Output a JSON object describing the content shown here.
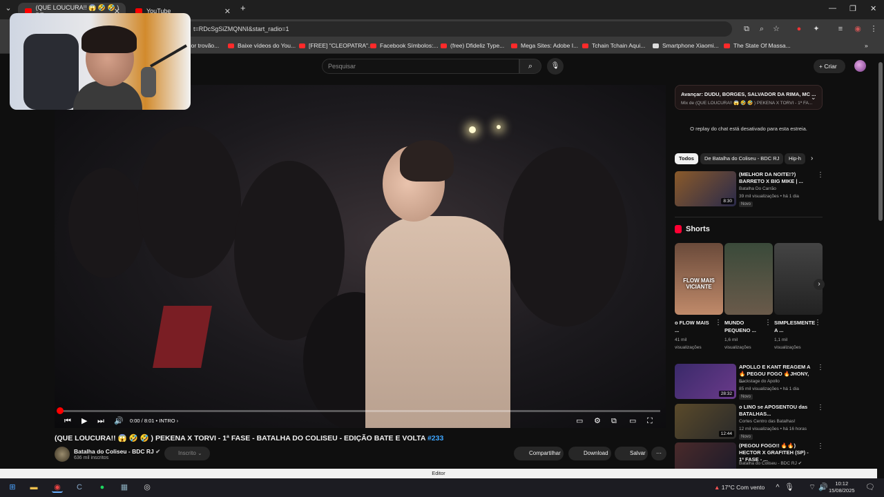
{
  "browser": {
    "tabs": [
      {
        "label": "(QUE LOUCURA!! 😱 🤣 🤣 ) PE"
      },
      {
        "label": "YouTube"
      }
    ],
    "url": "t=RDcSgSiZMQNNI&start_radio=1",
    "bookmarks": [
      "aior trovão...",
      "Baixe vídeos do You...",
      "[FREE] \"CLEOPATRA\"...",
      "Facebook Símbolos:...",
      "(free) Dfideliz Type...",
      "Mega Sites: Adobe I...",
      "Tchain Tchain Aqui...",
      "Smartphone Xiaomi...",
      "The State Of Massa..."
    ]
  },
  "youtube": {
    "search_placeholder": "Pesquisar",
    "create_label": "Criar"
  },
  "player": {
    "time": "0:00 / 8:01",
    "chapter": "INTRO",
    "progress_fraction": 0.0
  },
  "video": {
    "title": "(QUE LOUCURA!! 😱 🤣 🤣 ) PEKENA X TORVI - 1ª FASE - BATALHA DO COLISEU - EDIÇÃO BATE E VOLTA",
    "tag": "#233",
    "channel": "Batalha do Coliseu - BDC RJ",
    "subscribers": "636 mil inscritos",
    "subscribed_label": "Inscrito",
    "share_label": "Compartilhar",
    "download_label": "Download",
    "save_label": "Salvar"
  },
  "sidebar": {
    "mix_title": "Avançar: DUDU, BORGES, SALVADOR DA RIMA, MC ...",
    "mix_subtitle": "Mix de (QUE LOUCURA!! 😱 🤣 🤣 ) PEKENA X TORVI - 1ª FA...",
    "chat_off": "O replay do chat está desativado para esta estreia.",
    "chips": [
      "Todos",
      "De Batalha do Coliseu - BDC RJ",
      "Hip-h"
    ],
    "shorts_label": "Shorts",
    "recs": [
      {
        "title": "(MELHOR DA NOITE!?) BARRETO X BIG MIKE | ...",
        "channel": "Batalha Do Carrão",
        "meta": "39 mil visualizações • há 1 dia",
        "badge": "Novo",
        "duration": "8:30"
      },
      {
        "title": "APOLLO E KANT REAGEM A 🔥 PEGOU FOGO 🔥JHONY, ...",
        "channel": "Backstage do Apollo",
        "meta": "85 mil visualizações • há 1 dia",
        "badge": "Novo",
        "duration": "28:32"
      },
      {
        "title": "o LINO se APOSENTOU das BATALHAS...",
        "channel": "Cortes Centro das Batalhas!",
        "meta": "12 mil visualizações • há 16 horas",
        "badge": "Novo",
        "duration": "12:44"
      },
      {
        "title": "(PEGOU FOGO!! 🔥🔥) HECTOR X GRAFITEH (SP) - 1ª FASE - ...",
        "channel": "Batalha do Coliseu - BDC RJ ✔",
        "meta": "",
        "badge": "",
        "duration": ""
      }
    ],
    "shorts": [
      {
        "title": "o FLOW MAIS ...",
        "views": "41 mil visualizações",
        "overlay": "FLOW MAIS VICIANTE"
      },
      {
        "title": "MUNDO PEQUENO ...",
        "views": "1,6 mil visualizações",
        "overlay": ""
      },
      {
        "title": "SIMPLESMENTE A ...",
        "views": "1,1 mil visualizações",
        "overlay": ""
      }
    ]
  },
  "editor_label": "Editor",
  "taskbar": {
    "weather": "17°C  Com vento",
    "time": "10:12",
    "date": "15/08/2025"
  }
}
